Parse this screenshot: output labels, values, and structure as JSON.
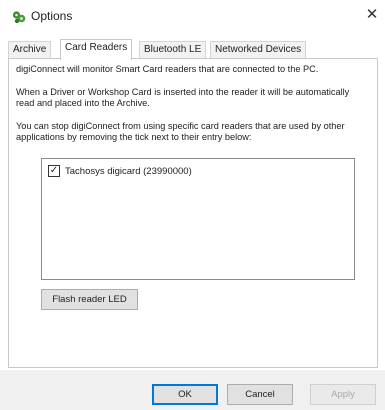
{
  "window": {
    "title": "Options",
    "close_symbol": "✕"
  },
  "tabs": [
    {
      "label": "Archive",
      "active": false
    },
    {
      "label": "Card Readers",
      "active": true
    },
    {
      "label": "Bluetooth LE",
      "active": false
    },
    {
      "label": "Networked Devices",
      "active": false
    }
  ],
  "card_readers": {
    "description_1": "digiConnect will monitor Smart Card readers that are connected to the PC.",
    "description_2": "When a Driver or Workshop Card is inserted into the reader it will be automatically read and placed into the Archive.",
    "description_3": "You can stop digiConnect from using specific card readers that are used by other applications by removing the tick next to their entry below:",
    "readers": [
      {
        "label": "Tachosys digicard (23990000)",
        "checked": true,
        "check_symbol": "✓"
      }
    ],
    "flash_button": "Flash reader LED"
  },
  "buttons": {
    "ok": "OK",
    "cancel": "Cancel",
    "apply": "Apply"
  },
  "icons": {
    "app_icon": "gear-cluster-icon",
    "close_icon": "close-icon"
  },
  "colors": {
    "accent": "#0078d7",
    "app_icon_green": "#3a8a2e",
    "disabled_text": "#a8a8a8"
  }
}
